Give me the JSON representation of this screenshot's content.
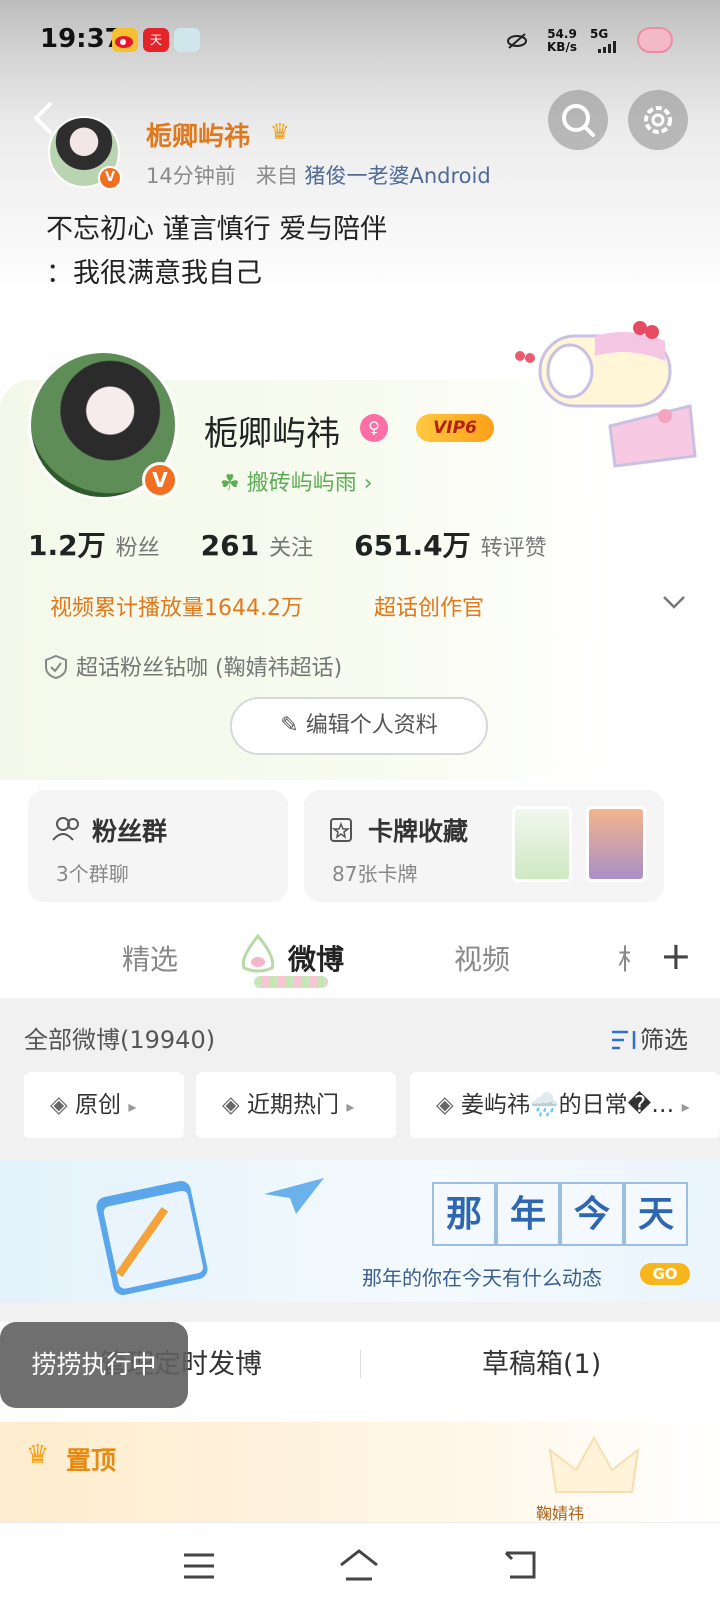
{
  "status_bar": {
    "time": "19:37",
    "app_icons": [
      "weibo-icon",
      "tmall-icon",
      "app-icon"
    ],
    "net_speed": "54.9",
    "net_unit": "KB/s",
    "network": "5G"
  },
  "post_header": {
    "username": "栀卿屿祎",
    "time_ago": "14分钟前",
    "source_prefix": "来自",
    "source": "猪俊一老婆Android",
    "text_line1": "不忘初心 谨言慎行 爱与陪伴",
    "text_line2": "：我很满意我自己"
  },
  "profile": {
    "name": "栀卿屿祎",
    "vip_label": "VIP6",
    "tag": "搬砖屿屿雨",
    "stats": [
      {
        "value": "1.2万",
        "label": "粉丝"
      },
      {
        "value": "261",
        "label": "关注"
      },
      {
        "value": "651.4万",
        "label": "转评赞"
      }
    ],
    "video_plays": "视频累计播放量1644.2万",
    "super_topic": "超话创作官",
    "fan_level": "超话粉丝钻咖 (鞠婧祎超话)",
    "edit_button": "编辑个人资料"
  },
  "tiles": {
    "fan_group_title": "粉丝群",
    "fan_group_sub": "3个群聊",
    "cards_title": "卡牌收藏",
    "cards_sub": "87张卡牌"
  },
  "tabs": [
    "精选",
    "微博",
    "视频",
    "相"
  ],
  "active_tab": "微博",
  "feed": {
    "all_label": "全部微博(19940)",
    "filter_label": "筛选",
    "chips": [
      "原创",
      "近期热门",
      "姜屿祎🌧️的日常�…"
    ],
    "banner_chars": [
      "那",
      "年",
      "今",
      "天"
    ],
    "banner_sub": "那年的你在今天有什么动态",
    "banner_go": "GO",
    "scheduled_label": "管理定时发博",
    "drafts_label": "草稿箱(1)",
    "toast": "捞捞执行中",
    "pinned_label": "置顶",
    "pinned_tag": "鞠婧祎"
  },
  "colors": {
    "accent_orange": "#e0781c",
    "verified": "#f26f22",
    "vip_gold": "#ffb32a",
    "green_tag": "#5bae56"
  }
}
